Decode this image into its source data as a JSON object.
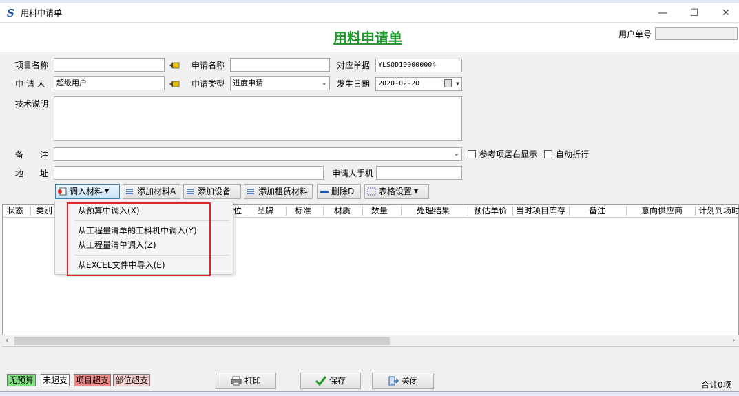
{
  "window": {
    "title": "用料申请单",
    "minimize": "—",
    "maximize": "☐",
    "close": "✕"
  },
  "header": {
    "form_title": "用料申请单",
    "user_no_label": "用户单号",
    "user_no_value": ""
  },
  "fields": {
    "project_name_label": "项目名称",
    "project_name_value": "",
    "apply_name_label": "申请名称",
    "apply_name_value": "",
    "ref_doc_label": "对应单据",
    "ref_doc_value": "YLSQD190000004",
    "applicant_label": "申 请 人",
    "applicant_value": "超级用户",
    "apply_type_label": "申请类型",
    "apply_type_value": "进度申请",
    "date_label": "发生日期",
    "date_value": "2020-02-20",
    "tech_label": "技术说明",
    "tech_value": "",
    "remark_label": "备　　注",
    "remark_value": "",
    "address_label": "地　　址",
    "address_value": "",
    "phone_label": "申请人手机",
    "phone_value": "",
    "chk_ref_right": "参考项居右显示",
    "chk_wrap": "自动折行"
  },
  "toolbar": {
    "import_material": "调入材料",
    "add_material": "添加材料A",
    "add_equipment": "添加设备",
    "add_lease": "添加租赁材料",
    "delete": "删除D",
    "table_settings": "表格设置"
  },
  "grid": {
    "columns": [
      "状态",
      "类别",
      "位",
      "品牌",
      "标准",
      "材质",
      "数量",
      "处理结果",
      "预估单价",
      "当时项目库存",
      "备注",
      "意向供应商",
      "计划到场时"
    ]
  },
  "menu": {
    "items": [
      "从预算中调入(X)",
      "从工程量清单的工料机中调入(Y)",
      "从工程量清单调入(Z)",
      "从EXCEL文件中导入(E)"
    ]
  },
  "legend": {
    "no_budget": "无预算",
    "not_over": "未超支",
    "project_over": "项目超支",
    "part_over": "部位超支"
  },
  "buttons": {
    "print": "打印",
    "save": "保存",
    "close": "关闭"
  },
  "footer": {
    "total": "合计0项"
  },
  "colors": {
    "title_green": "#1f9a2a",
    "legend_green": "#7ee07e",
    "legend_red": "#f08a8a",
    "legend_pink": "#f7d0d0",
    "highlight_red": "#e0262a"
  }
}
